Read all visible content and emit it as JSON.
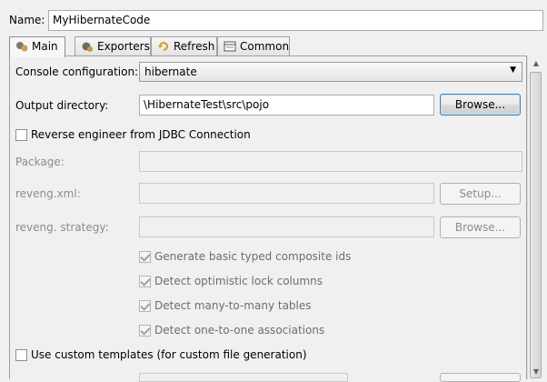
{
  "name": {
    "label": "Name:",
    "value": "MyHibernateCode"
  },
  "tabs": [
    {
      "label": "Main",
      "icon": "hibernate-main-icon"
    },
    {
      "label": "Exporters",
      "icon": "exporters-icon"
    },
    {
      "label": "Refresh",
      "icon": "refresh-icon"
    },
    {
      "label": "Common",
      "icon": "common-icon"
    }
  ],
  "main": {
    "console_label": "Console configuration:",
    "console_value": "hibernate",
    "output_label": "Output directory:",
    "output_value": "\\HibernateTest\\src\\pojo",
    "browse_label": "Browse...",
    "reverse_label": "Reverse engineer from JDBC Connection",
    "package_label": "Package:",
    "package_value": "",
    "revengxml_label": "reveng.xml:",
    "revengxml_value": "",
    "setup_label": "Setup...",
    "strategy_label": "reveng. strategy:",
    "strategy_value": "",
    "browse2_label": "Browse...",
    "opt_composite": "Generate basic typed composite ids",
    "opt_lock": "Detect optimistic lock columns",
    "opt_m2m": "Detect many-to-many tables",
    "opt_o2o": "Detect one-to-one associations",
    "custom_templates": "Use custom templates (for custom file generation)"
  }
}
